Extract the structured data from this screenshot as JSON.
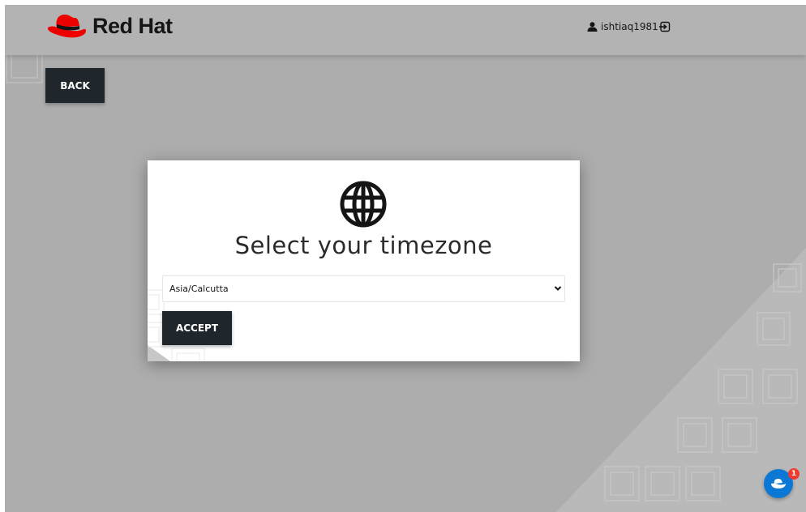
{
  "header": {
    "brand_name": "Red Hat",
    "logo_icon": "red-hat-fedora-icon",
    "username": "ishtiaq1981",
    "user_icon": "user-icon",
    "logout_icon": "sign-out-icon"
  },
  "page": {
    "back_label": "BACK"
  },
  "modal": {
    "icon": "globe-icon",
    "title": "Select your timezone",
    "timezone_selected": "Asia/Calcutta",
    "accept_label": "ACCEPT"
  },
  "chat_widget": {
    "icon": "red-hat-chat-icon",
    "notification_count": "1"
  },
  "colors": {
    "brand_red": "#ee0000",
    "button_dark": "#1f272c",
    "chat_blue": "#0b78d6",
    "badge_red": "#ee3a2f",
    "background_gray": "#adadad"
  }
}
